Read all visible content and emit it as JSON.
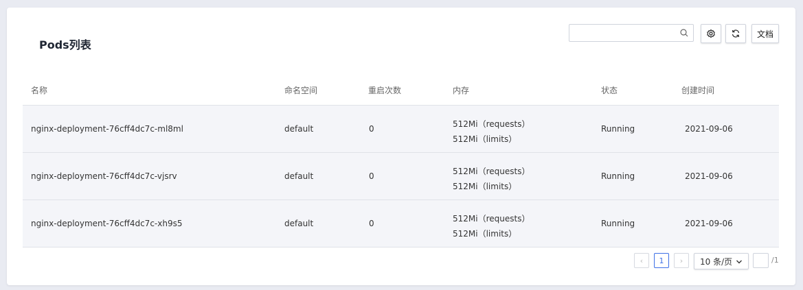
{
  "page": {
    "title": "Pods列表"
  },
  "toolbar": {
    "search_placeholder": "",
    "search_icon": "search-icon",
    "settings_icon": "gear-icon",
    "refresh_icon": "refresh-icon",
    "docs_label": "文档"
  },
  "table": {
    "columns": [
      "名称",
      "命名空间",
      "重启次数",
      "内存",
      "状态",
      "创建时间"
    ],
    "rows": [
      {
        "name": "nginx-deployment-76cff4dc7c-ml8ml",
        "namespace": "default",
        "restarts": "0",
        "mem_requests": "512Mi（requests）",
        "mem_limits": "512Mi（limits）",
        "status": "Running",
        "created": "2021-09-06"
      },
      {
        "name": "nginx-deployment-76cff4dc7c-vjsrv",
        "namespace": "default",
        "restarts": "0",
        "mem_requests": "512Mi（requests）",
        "mem_limits": "512Mi（limits）",
        "status": "Running",
        "created": "2021-09-06"
      },
      {
        "name": "nginx-deployment-76cff4dc7c-xh9s5",
        "namespace": "default",
        "restarts": "0",
        "mem_requests": "512Mi（requests）",
        "mem_limits": "512Mi（limits）",
        "status": "Running",
        "created": "2021-09-06"
      }
    ]
  },
  "pagination": {
    "prev": "‹",
    "current_page": "1",
    "next": "›",
    "page_size": "10 条/页",
    "total_pages": "/1"
  },
  "colors": {
    "accent": "#3d6fe6",
    "row_bg": "#f4f5f9",
    "page_bg": "#e9ebf2"
  }
}
